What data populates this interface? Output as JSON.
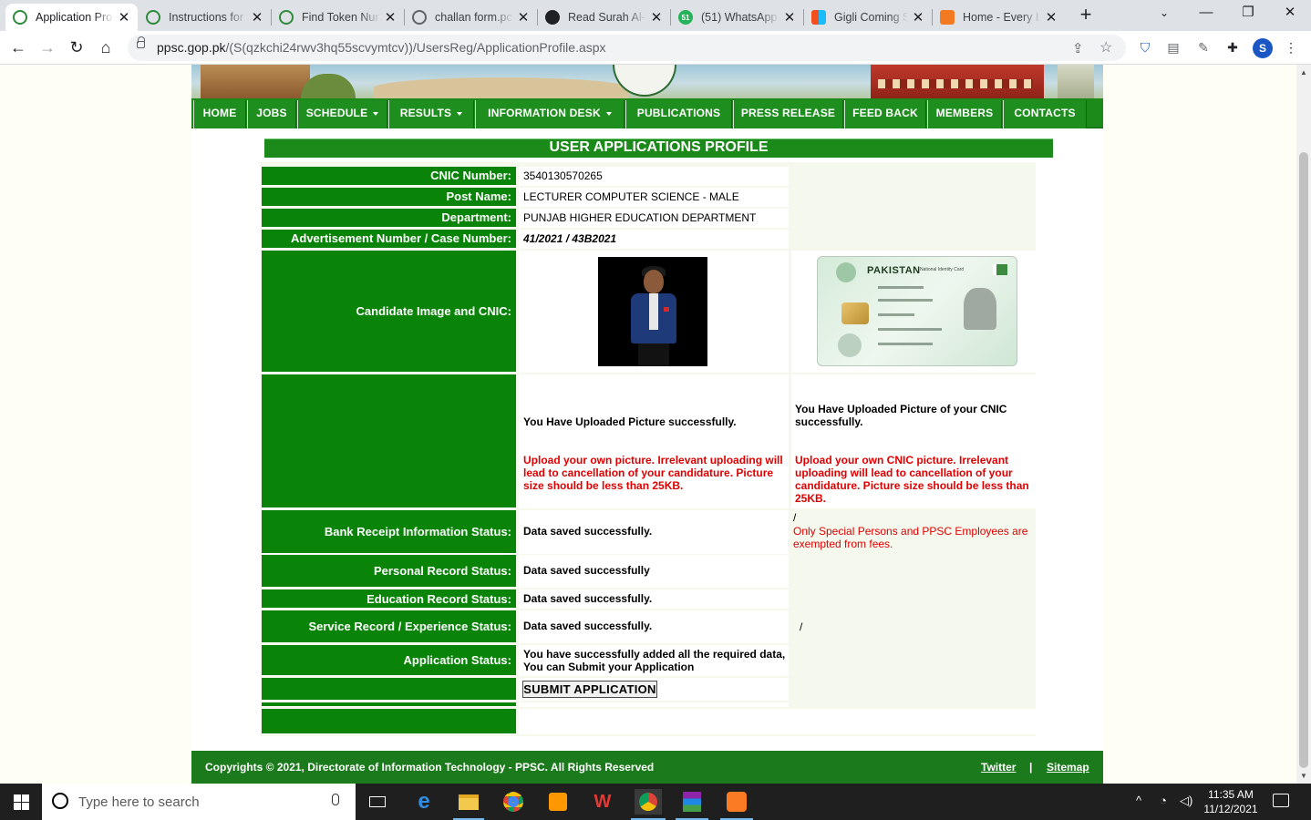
{
  "browser": {
    "tabs": [
      {
        "title": "Application Pro",
        "active": true,
        "icon": "ppsc-icon"
      },
      {
        "title": "Instructions for",
        "active": false,
        "icon": "ppsc-icon"
      },
      {
        "title": "Find Token Nur",
        "active": false,
        "icon": "ppsc-icon"
      },
      {
        "title": "challan form.pc",
        "active": false,
        "icon": "globe-icon"
      },
      {
        "title": "Read Surah Al-",
        "active": false,
        "icon": "quran-icon"
      },
      {
        "title": "(51) WhatsApp",
        "active": false,
        "icon": "whatsapp-icon"
      },
      {
        "title": "Gigli Coming S",
        "active": false,
        "icon": "figma-icon"
      },
      {
        "title": "Home - Every I",
        "active": false,
        "icon": "xampp-icon"
      }
    ],
    "url_host": "ppsc.gop.pk",
    "url_path": "/(S(qzkchi24rwv3hq55scvymtcv))/UsersReg/ApplicationProfile.aspx",
    "profile_initial": "S"
  },
  "site": {
    "menu": [
      {
        "label": "HOME",
        "dropdown": false
      },
      {
        "label": "JOBS",
        "dropdown": false
      },
      {
        "label": "SCHEDULE",
        "dropdown": true
      },
      {
        "label": "RESULTS",
        "dropdown": true
      },
      {
        "label": "INFORMATION DESK",
        "dropdown": true
      },
      {
        "label": "PUBLICATIONS",
        "dropdown": false
      },
      {
        "label": "PRESS RELEASE",
        "dropdown": false
      },
      {
        "label": "FEED BACK",
        "dropdown": false
      },
      {
        "label": "MEMBERS",
        "dropdown": false
      },
      {
        "label": "CONTACTS",
        "dropdown": false
      }
    ],
    "page_title": "USER APPLICATIONS PROFILE"
  },
  "profile": {
    "cnic_label": "CNIC Number:",
    "cnic_value": "3540130570265",
    "post_label": "Post Name:",
    "post_value": "LECTURER COMPUTER SCIENCE - MALE",
    "dept_label": "Department:",
    "dept_value": "PUNJAB HIGHER EDUCATION DEPARTMENT",
    "advert_label": "Advertisement Number / Case Number:",
    "advert_value": "41/2021 / 43B2021",
    "image_label": "Candidate Image and CNIC:",
    "cnic_card_title": "PAKISTAN",
    "cnic_card_sub": "National Identity Card",
    "picture_ok": "You Have Uploaded Picture successfully.",
    "picture_warning": "Upload your own picture. Irrelevant uploading will lead to cancellation of your candidature. Picture size should be less than 25KB.",
    "cnic_ok": "You Have Uploaded Picture of your CNIC successfully.",
    "cnic_warning": "Upload your own CNIC picture. Irrelevant uploading will lead to cancellation of your candidature. Picture size should be less than 25KB.",
    "bank_label": "Bank Receipt Information Status:",
    "bank_value": "Data saved successfully.",
    "bank_slash": "/",
    "bank_note": "Only Special Persons and PPSC Employees are exempted from fees.",
    "personal_label": "Personal Record Status:",
    "personal_value": "Data saved successfully",
    "education_label": "Education Record Status:",
    "education_value": "Data saved successfully.",
    "service_label": "Service Record / Experience Status:",
    "service_value": "Data saved successfully.",
    "service_slash": "/",
    "app_label": "Application Status:",
    "app_value": "You have successfully added all the required data, You can Submit your Application",
    "submit_label": "SUBMIT APPLICATION"
  },
  "footer": {
    "copyright": "Copyrights © 2021, Directorate of Information Technology - PPSC. All Rights Reserved",
    "twitter": "Twitter",
    "separator": "|",
    "sitemap": "Sitemap"
  },
  "taskbar": {
    "search_placeholder": "Type here to search",
    "time": "11:35 AM",
    "date": "11/12/2021"
  }
}
